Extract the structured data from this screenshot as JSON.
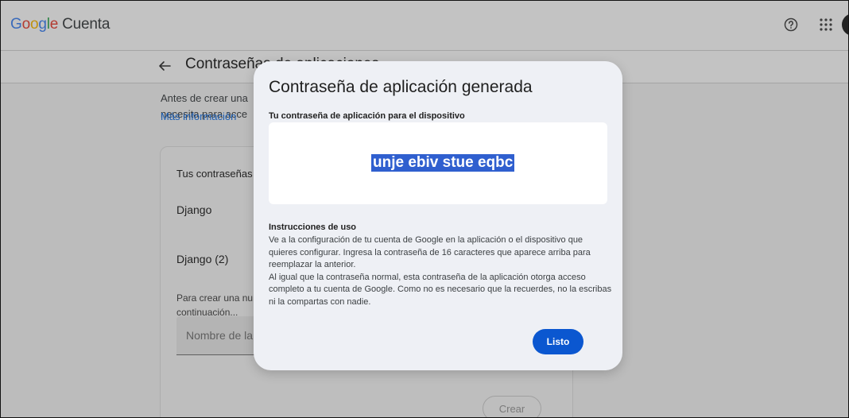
{
  "header": {
    "brand_letters": [
      "G",
      "o",
      "o",
      "g",
      "l",
      "e"
    ],
    "product": "Cuenta",
    "icons": {
      "help": "help-icon",
      "apps": "apps-grid-icon",
      "avatar": "avatar"
    }
  },
  "subheader": {
    "title": "Contraseñas de aplicaciones"
  },
  "main": {
    "intro_line1": "Antes de crear una",
    "intro_line2": "necesita para acce",
    "more_link": "Más información",
    "card": {
      "title": "Tus contraseñas",
      "apps": [
        "Django",
        "Django (2)"
      ],
      "create_hint": "Para crear una nu",
      "create_hint2": "continuación...",
      "name_placeholder": "Nombre de la",
      "create_button": "Crear"
    }
  },
  "dialog": {
    "title": "Contraseña de aplicación generada",
    "subtitle": "Tu contraseña de aplicación para el dispositivo",
    "password": "unje ebiv stue eqbc",
    "instructions_title": "Instrucciones de uso",
    "instructions_p1": "Ve a la configuración de tu cuenta de Google en la aplicación o el dispositivo que quieres configurar. Ingresa la contraseña de 16 caracteres que aparece arriba para reemplazar la anterior.",
    "instructions_p2": "Al igual que la contraseña normal, esta contraseña de la aplicación otorga acceso completo a tu cuenta de Google. Como no es necesario que la recuerdes, no la escribas ni la compartas con nadie.",
    "done_button": "Listo"
  },
  "colors": {
    "primary": "#0b57d0",
    "link": "#1a73e8",
    "selection": "#2f5fcf"
  }
}
